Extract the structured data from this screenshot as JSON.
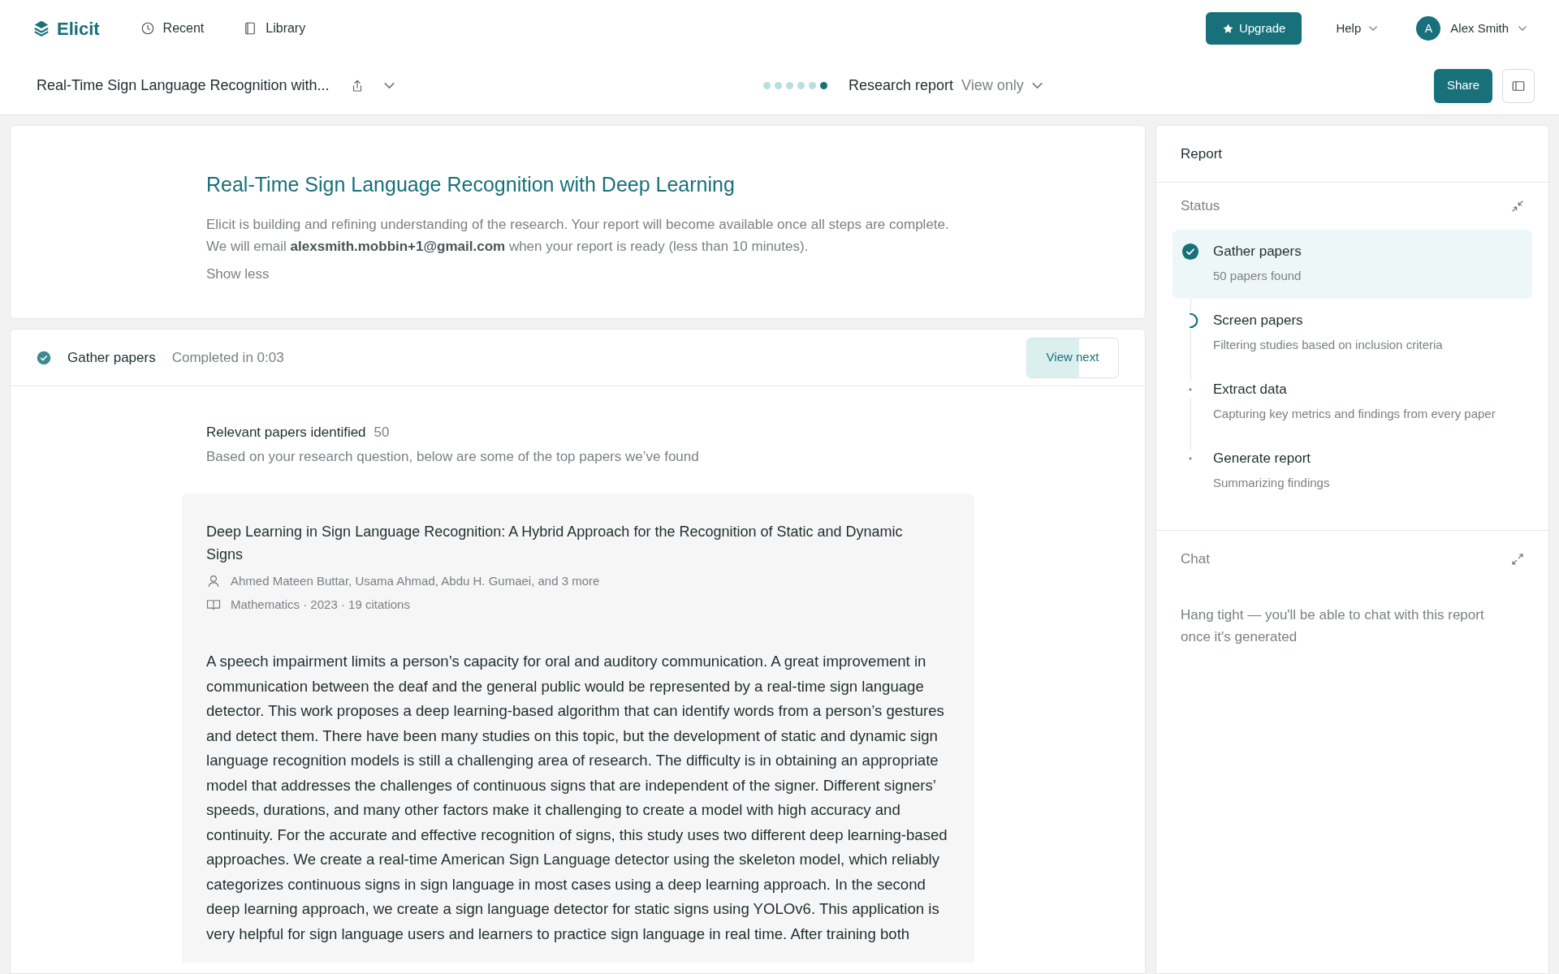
{
  "nav": {
    "logo": "Elicit",
    "links": [
      {
        "label": "Recent",
        "kind": "recent"
      },
      {
        "label": "Library",
        "kind": "library"
      }
    ],
    "upgrade": "Upgrade",
    "help": "Help",
    "user": {
      "initial": "A",
      "name": "Alex Smith"
    }
  },
  "doc_bar": {
    "title": "Real-Time Sign Language Recognition with...",
    "progress_dots": [
      {
        "active": false
      },
      {
        "active": false
      },
      {
        "active": false
      },
      {
        "active": false
      },
      {
        "active": false
      },
      {
        "active": true
      }
    ],
    "report_type": "Research report",
    "access": "View only",
    "share": "Share"
  },
  "intro": {
    "title": "Real-Time Sign Language Recognition with Deep Learning",
    "message": "Elicit is building and refining understanding of the research. Your report will become available once all steps are complete. We will email **alexsmith.mobbin+1@gmail.com** when your report is ready (less than 10 minutes).",
    "toggle": "Show less"
  },
  "step": {
    "name": "Gather papers",
    "done": true,
    "duration": "Completed in 0:03",
    "view_next": {
      "label": "View next",
      "level": 0.57
    },
    "summary_label": "Relevant papers identified",
    "summary_count": "50",
    "summary_note": "Based on your research question, below are some of the top papers we’ve found",
    "paper": {
      "title": "Deep Learning in Sign Language Recognition: A Hybrid Approach for the Recognition of Static and Dynamic Signs",
      "authors": "Ahmed Mateen Buttar, Usama Ahmad, Abdu H. Gumaei, and 3 more",
      "meta": "Mathematics · 2023 · 19 citations",
      "abstract": "A speech impairment limits a person’s capacity for oral and auditory communication. A great improvement in communication between the deaf and the general public would be represented by a real-time sign language detector. This work proposes a deep learning-based algorithm that can identify words from a person’s gestures and detect them. There have been many studies on this topic, but the development of static and dynamic sign language recognition models is still a challenging area of research. The difficulty is in obtaining an appropriate model that addresses the challenges of continuous signs that are independent of the signer. Different signers’ speeds, durations, and many other factors make it challenging to create a model with high accuracy and continuity. For the accurate and effective recognition of signs, this study uses two different deep learning-based approaches. We create a real-time American Sign Language detector using the skeleton model, which reliably categorizes continuous signs in sign language in most cases using a deep learning approach. In the second deep learning approach, we create a sign language detector for static signs using YOLOv6. This application is very helpful for sign language users and learners to practice sign language in real time. After training both"
    }
  },
  "report_panel": {
    "title": "Report",
    "status_heading": "Status",
    "steps": [
      {
        "name": "Gather papers",
        "detail": "50 papers found",
        "kind": "done",
        "selected": true
      },
      {
        "name": "Screen papers",
        "detail": "Filtering studies based on inclusion criteria",
        "kind": "running",
        "selected": false
      },
      {
        "name": "Extract data",
        "detail": "Capturing key metrics and findings from every paper",
        "kind": "pending",
        "selected": false
      },
      {
        "name": "Generate report",
        "detail": "Summarizing findings",
        "kind": "pending",
        "selected": false
      }
    ],
    "chat_heading": "Chat",
    "chat_note": "Hang tight — you'll be able to chat with this report once it's generated"
  }
}
